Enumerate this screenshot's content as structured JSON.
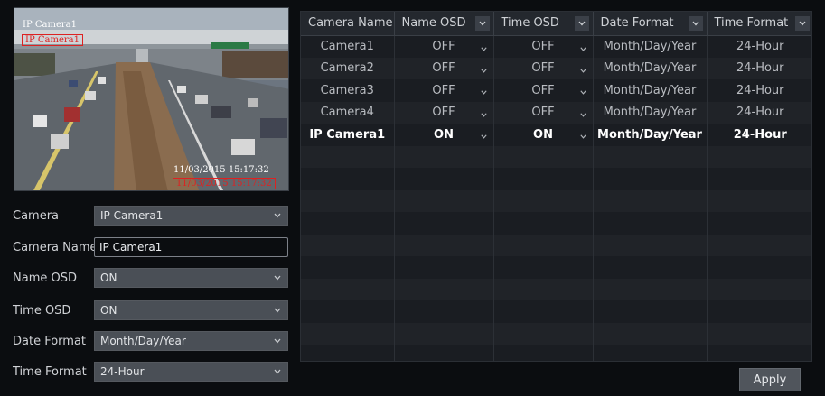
{
  "preview": {
    "osd_name": "IP Camera1",
    "osd_name_highlight": "IP Camera1",
    "osd_time": "11/03/2015 15:17:32",
    "osd_time_highlight": "11/03/2015 15:17:32"
  },
  "form": {
    "camera": {
      "label": "Camera",
      "value": "IP Camera1"
    },
    "camera_name": {
      "label": "Camera Name",
      "value": "IP Camera1"
    },
    "name_osd": {
      "label": "Name OSD",
      "value": "ON"
    },
    "time_osd": {
      "label": "Time OSD",
      "value": "ON"
    },
    "date_format": {
      "label": "Date Format",
      "value": "Month/Day/Year"
    },
    "time_format": {
      "label": "Time Format",
      "value": "24-Hour"
    }
  },
  "table": {
    "headers": [
      "Camera Name",
      "Name OSD",
      "Time OSD",
      "Date Format",
      "Time Format"
    ],
    "rows": [
      [
        "Camera1",
        "OFF",
        "OFF",
        "Month/Day/Year",
        "24-Hour"
      ],
      [
        "Camera2",
        "OFF",
        "OFF",
        "Month/Day/Year",
        "24-Hour"
      ],
      [
        "Camera3",
        "OFF",
        "OFF",
        "Month/Day/Year",
        "24-Hour"
      ],
      [
        "Camera4",
        "OFF",
        "OFF",
        "Month/Day/Year",
        "24-Hour"
      ],
      [
        "IP Camera1",
        "ON",
        "ON",
        "Month/Day/Year",
        "24-Hour"
      ]
    ],
    "selected_row": 4
  },
  "apply_label": "Apply",
  "colors": {
    "osd_highlight": "#dd2222",
    "background": "#0b0d10"
  }
}
